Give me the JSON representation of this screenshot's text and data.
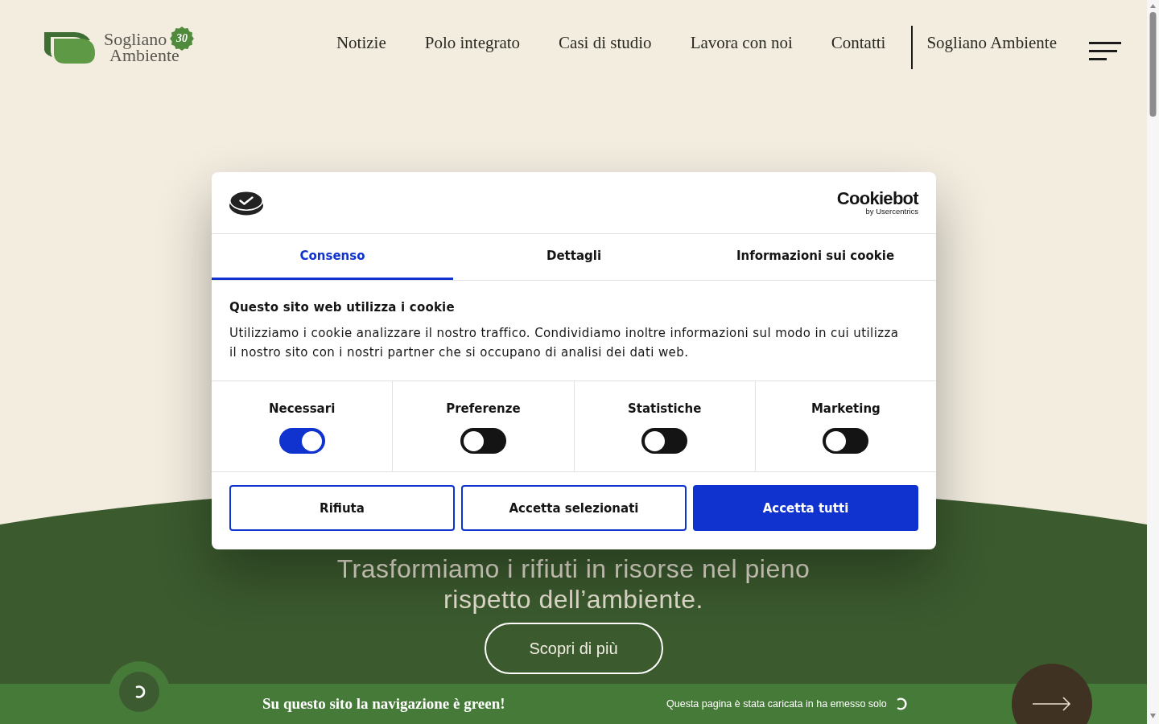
{
  "header": {
    "logo": {
      "lines": [
        "Sogliano",
        "Ambiente"
      ],
      "badge": "30"
    },
    "nav": [
      "Notizie",
      "Polo integrato",
      "Casi di studio",
      "Lavora con noi",
      "Contatti"
    ],
    "nav_secondary": "Sogliano Ambiente"
  },
  "hero": {
    "heading": "Trasformiamo i rifiuti in risorse nel pieno rispetto dell’ambiente.",
    "button": "Scopri di più"
  },
  "cookie_dialog": {
    "brand": "Cookiebot",
    "brand_subtitle": "by Usercentrics",
    "tabs": [
      {
        "label": "Consenso",
        "selected": true
      },
      {
        "label": "Dettagli",
        "selected": false
      },
      {
        "label": "Informazioni sui cookie",
        "selected": false
      }
    ],
    "title": "Questo sito web utilizza i cookie",
    "description": "Utilizziamo i cookie analizzare il nostro traffico. Condividiamo inoltre informazioni sul modo in cui utilizza il nostro sito con i nostri partner che si occupano di analisi dei dati web.",
    "categories": [
      {
        "label": "Necessari",
        "checked": true
      },
      {
        "label": "Preferenze",
        "checked": false
      },
      {
        "label": "Statistiche",
        "checked": false
      },
      {
        "label": "Marketing",
        "checked": false
      }
    ],
    "buttons": [
      {
        "label": "Rifiuta",
        "kind": "outline"
      },
      {
        "label": "Accetta selezionati",
        "kind": "outline"
      },
      {
        "label": "Accetta tutti",
        "kind": "filled"
      }
    ]
  },
  "green_bar": {
    "title": "Su questo sito la navigazione è green!",
    "note": "Questa pagina è stata caricata in ha emesso solo"
  }
}
